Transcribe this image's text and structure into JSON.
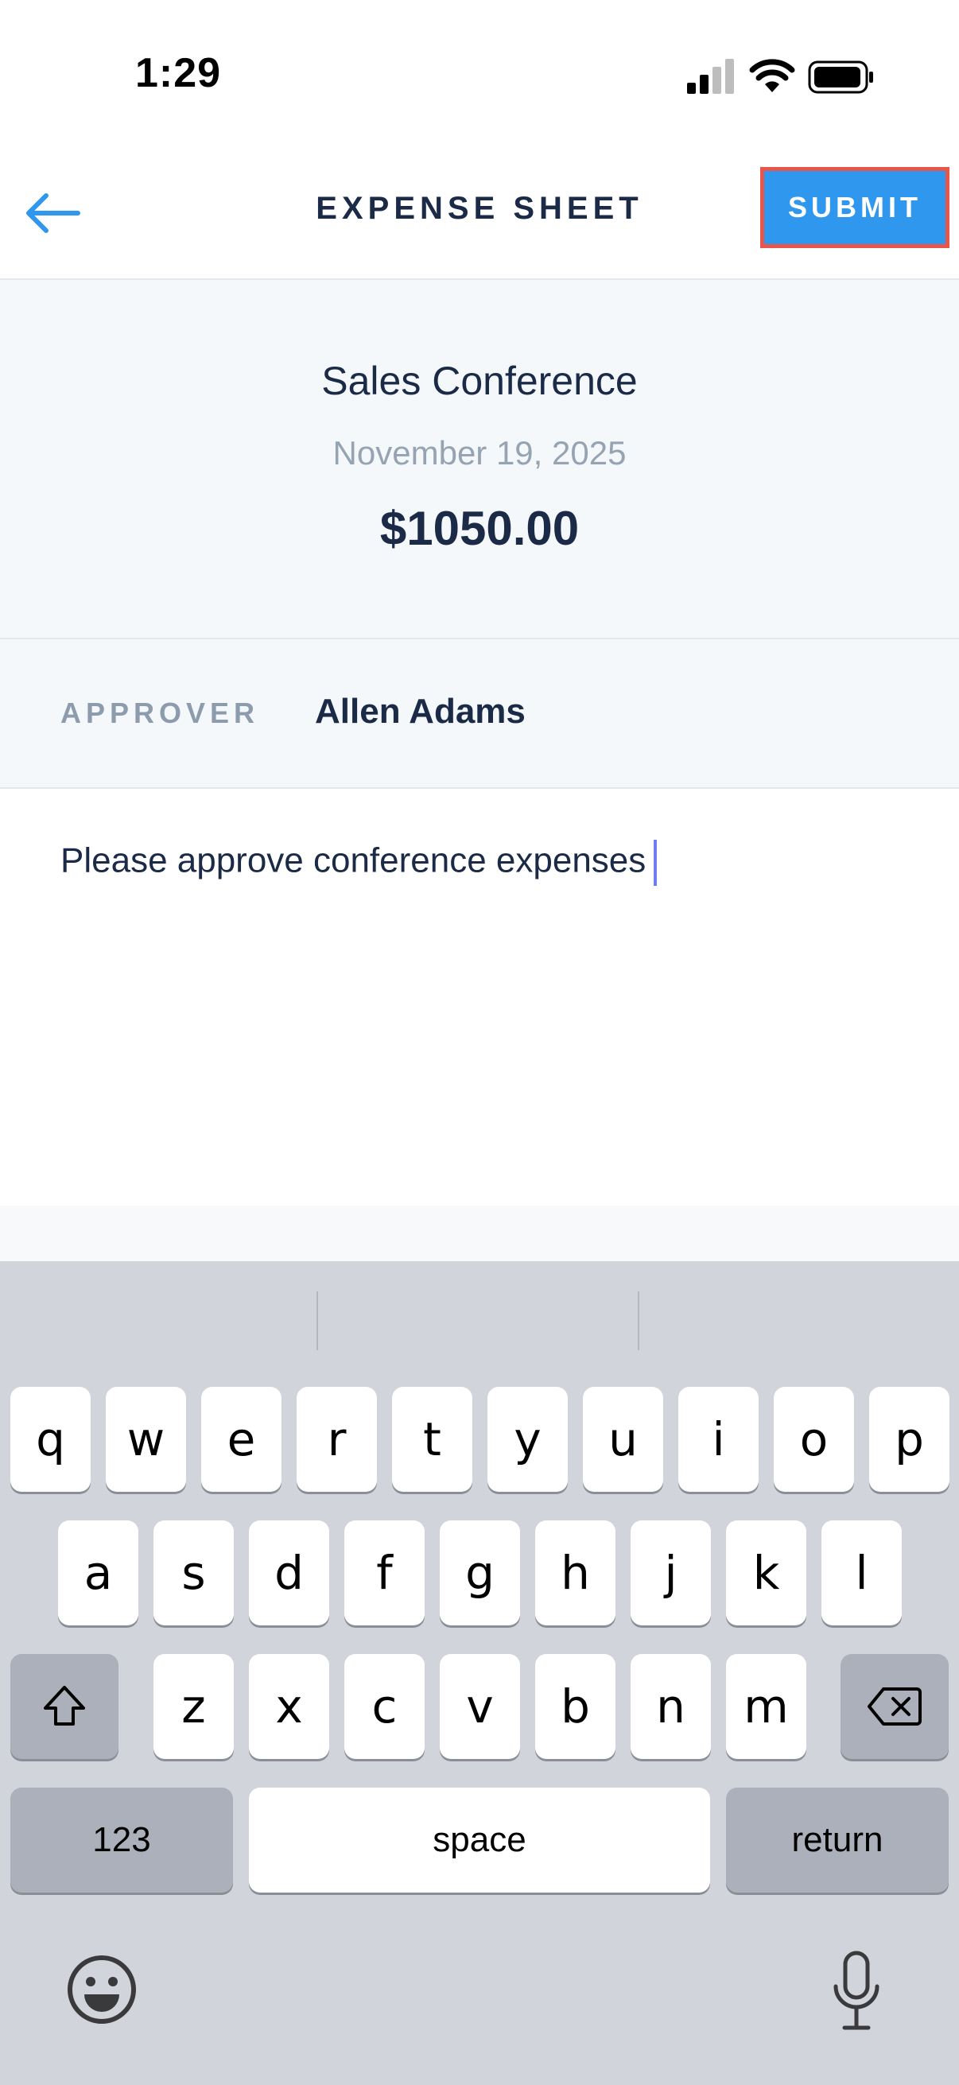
{
  "status_bar": {
    "time": "1:29"
  },
  "nav": {
    "title": "EXPENSE SHEET",
    "submit_label": "SUBMIT"
  },
  "summary": {
    "title": "Sales Conference",
    "date": "November 19, 2025",
    "amount": "$1050.00"
  },
  "approver": {
    "label": "APPROVER",
    "name": "Allen Adams"
  },
  "notes": {
    "text": "Please approve conference expenses"
  },
  "keyboard": {
    "row1": [
      "q",
      "w",
      "e",
      "r",
      "t",
      "y",
      "u",
      "i",
      "o",
      "p"
    ],
    "row2": [
      "a",
      "s",
      "d",
      "f",
      "g",
      "h",
      "j",
      "k",
      "l"
    ],
    "row3": [
      "z",
      "x",
      "c",
      "v",
      "b",
      "n",
      "m"
    ],
    "numbers_label": "123",
    "space_label": "space",
    "return_label": "return"
  },
  "colors": {
    "accent": "#2f97ee",
    "highlight_border": "#e8554a",
    "text": "#1b2b47"
  }
}
